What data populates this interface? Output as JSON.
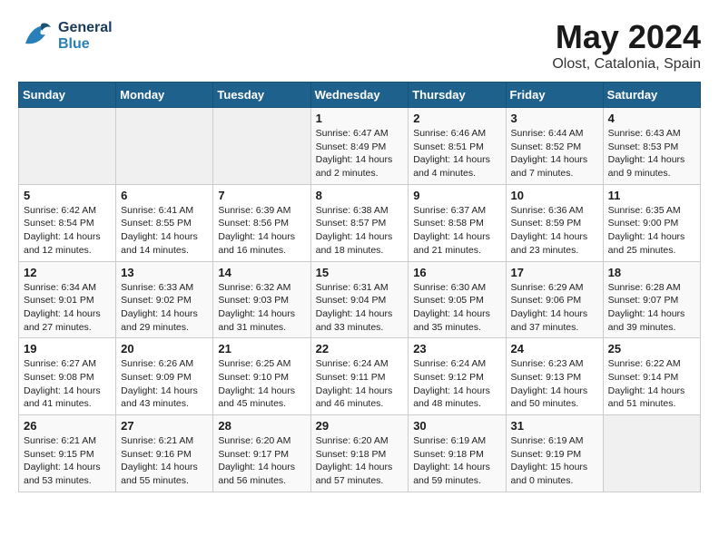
{
  "logo": {
    "general": "General",
    "blue": "Blue"
  },
  "title": "May 2024",
  "subtitle": "Olost, Catalonia, Spain",
  "weekdays": [
    "Sunday",
    "Monday",
    "Tuesday",
    "Wednesday",
    "Thursday",
    "Friday",
    "Saturday"
  ],
  "weeks": [
    [
      {
        "day": "",
        "content": ""
      },
      {
        "day": "",
        "content": ""
      },
      {
        "day": "",
        "content": ""
      },
      {
        "day": "1",
        "content": "Sunrise: 6:47 AM\nSunset: 8:49 PM\nDaylight: 14 hours\nand 2 minutes."
      },
      {
        "day": "2",
        "content": "Sunrise: 6:46 AM\nSunset: 8:51 PM\nDaylight: 14 hours\nand 4 minutes."
      },
      {
        "day": "3",
        "content": "Sunrise: 6:44 AM\nSunset: 8:52 PM\nDaylight: 14 hours\nand 7 minutes."
      },
      {
        "day": "4",
        "content": "Sunrise: 6:43 AM\nSunset: 8:53 PM\nDaylight: 14 hours\nand 9 minutes."
      }
    ],
    [
      {
        "day": "5",
        "content": "Sunrise: 6:42 AM\nSunset: 8:54 PM\nDaylight: 14 hours\nand 12 minutes."
      },
      {
        "day": "6",
        "content": "Sunrise: 6:41 AM\nSunset: 8:55 PM\nDaylight: 14 hours\nand 14 minutes."
      },
      {
        "day": "7",
        "content": "Sunrise: 6:39 AM\nSunset: 8:56 PM\nDaylight: 14 hours\nand 16 minutes."
      },
      {
        "day": "8",
        "content": "Sunrise: 6:38 AM\nSunset: 8:57 PM\nDaylight: 14 hours\nand 18 minutes."
      },
      {
        "day": "9",
        "content": "Sunrise: 6:37 AM\nSunset: 8:58 PM\nDaylight: 14 hours\nand 21 minutes."
      },
      {
        "day": "10",
        "content": "Sunrise: 6:36 AM\nSunset: 8:59 PM\nDaylight: 14 hours\nand 23 minutes."
      },
      {
        "day": "11",
        "content": "Sunrise: 6:35 AM\nSunset: 9:00 PM\nDaylight: 14 hours\nand 25 minutes."
      }
    ],
    [
      {
        "day": "12",
        "content": "Sunrise: 6:34 AM\nSunset: 9:01 PM\nDaylight: 14 hours\nand 27 minutes."
      },
      {
        "day": "13",
        "content": "Sunrise: 6:33 AM\nSunset: 9:02 PM\nDaylight: 14 hours\nand 29 minutes."
      },
      {
        "day": "14",
        "content": "Sunrise: 6:32 AM\nSunset: 9:03 PM\nDaylight: 14 hours\nand 31 minutes."
      },
      {
        "day": "15",
        "content": "Sunrise: 6:31 AM\nSunset: 9:04 PM\nDaylight: 14 hours\nand 33 minutes."
      },
      {
        "day": "16",
        "content": "Sunrise: 6:30 AM\nSunset: 9:05 PM\nDaylight: 14 hours\nand 35 minutes."
      },
      {
        "day": "17",
        "content": "Sunrise: 6:29 AM\nSunset: 9:06 PM\nDaylight: 14 hours\nand 37 minutes."
      },
      {
        "day": "18",
        "content": "Sunrise: 6:28 AM\nSunset: 9:07 PM\nDaylight: 14 hours\nand 39 minutes."
      }
    ],
    [
      {
        "day": "19",
        "content": "Sunrise: 6:27 AM\nSunset: 9:08 PM\nDaylight: 14 hours\nand 41 minutes."
      },
      {
        "day": "20",
        "content": "Sunrise: 6:26 AM\nSunset: 9:09 PM\nDaylight: 14 hours\nand 43 minutes."
      },
      {
        "day": "21",
        "content": "Sunrise: 6:25 AM\nSunset: 9:10 PM\nDaylight: 14 hours\nand 45 minutes."
      },
      {
        "day": "22",
        "content": "Sunrise: 6:24 AM\nSunset: 9:11 PM\nDaylight: 14 hours\nand 46 minutes."
      },
      {
        "day": "23",
        "content": "Sunrise: 6:24 AM\nSunset: 9:12 PM\nDaylight: 14 hours\nand 48 minutes."
      },
      {
        "day": "24",
        "content": "Sunrise: 6:23 AM\nSunset: 9:13 PM\nDaylight: 14 hours\nand 50 minutes."
      },
      {
        "day": "25",
        "content": "Sunrise: 6:22 AM\nSunset: 9:14 PM\nDaylight: 14 hours\nand 51 minutes."
      }
    ],
    [
      {
        "day": "26",
        "content": "Sunrise: 6:21 AM\nSunset: 9:15 PM\nDaylight: 14 hours\nand 53 minutes."
      },
      {
        "day": "27",
        "content": "Sunrise: 6:21 AM\nSunset: 9:16 PM\nDaylight: 14 hours\nand 55 minutes."
      },
      {
        "day": "28",
        "content": "Sunrise: 6:20 AM\nSunset: 9:17 PM\nDaylight: 14 hours\nand 56 minutes."
      },
      {
        "day": "29",
        "content": "Sunrise: 6:20 AM\nSunset: 9:18 PM\nDaylight: 14 hours\nand 57 minutes."
      },
      {
        "day": "30",
        "content": "Sunrise: 6:19 AM\nSunset: 9:18 PM\nDaylight: 14 hours\nand 59 minutes."
      },
      {
        "day": "31",
        "content": "Sunrise: 6:19 AM\nSunset: 9:19 PM\nDaylight: 15 hours\nand 0 minutes."
      },
      {
        "day": "",
        "content": ""
      }
    ]
  ]
}
